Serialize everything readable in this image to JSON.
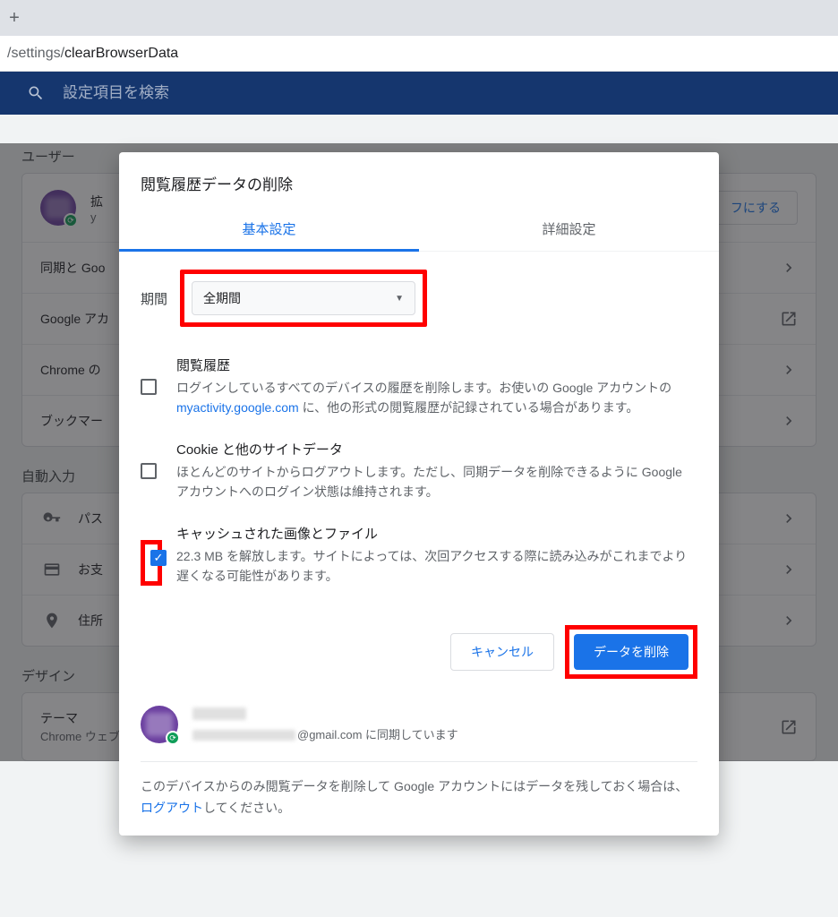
{
  "chrome": {
    "url_path": "/settings/",
    "url_page": "clearBrowserData"
  },
  "search": {
    "placeholder": "設定項目を検索"
  },
  "sections": {
    "user": {
      "label": "ユーザー"
    },
    "autofill": {
      "label": "自動入力"
    },
    "design": {
      "label": "デザイン"
    }
  },
  "user_card": {
    "profile_name": "拡",
    "profile_sub": "y",
    "turn_off": "フにする",
    "sync": "同期と Goo",
    "google_account": "Google アカ",
    "chrome_name": "Chrome の",
    "bookmarks": "ブックマー"
  },
  "autofill_card": {
    "passwords": "パス",
    "payments": "お支",
    "addresses": "住所"
  },
  "design_card": {
    "theme_title": "テーマ",
    "theme_sub": "Chrome ウェブストアを開きます"
  },
  "dialog": {
    "title": "閲覧履歴データの削除",
    "tabs": {
      "basic": "基本設定",
      "advanced": "詳細設定"
    },
    "time_label": "期間",
    "time_value": "全期間",
    "items": {
      "history": {
        "title": "閲覧履歴",
        "desc_a": "ログインしているすべてのデバイスの履歴を削除します。お使いの Google アカウントの ",
        "link": "myactivity.google.com",
        "desc_b": " に、他の形式の閲覧履歴が記録されている場合があります。",
        "checked": false
      },
      "cookies": {
        "title": "Cookie と他のサイトデータ",
        "desc": "ほとんどのサイトからログアウトします。ただし、同期データを削除できるように Google アカウントへのログイン状態は維持されます。",
        "checked": false
      },
      "cache": {
        "title": "キャッシュされた画像とファイル",
        "desc": "22.3 MB を解放します。サイトによっては、次回アクセスする際に読み込みがこれまでより遅くなる可能性があります。",
        "checked": true
      }
    },
    "cancel": "キャンセル",
    "confirm": "データを削除",
    "sync_suffix": "@gmail.com に同期しています",
    "footer_a": "このデバイスからのみ閲覧データを削除して Google アカウントにはデータを残しておく場合は、",
    "footer_link": "ログアウト",
    "footer_b": "してください。"
  }
}
